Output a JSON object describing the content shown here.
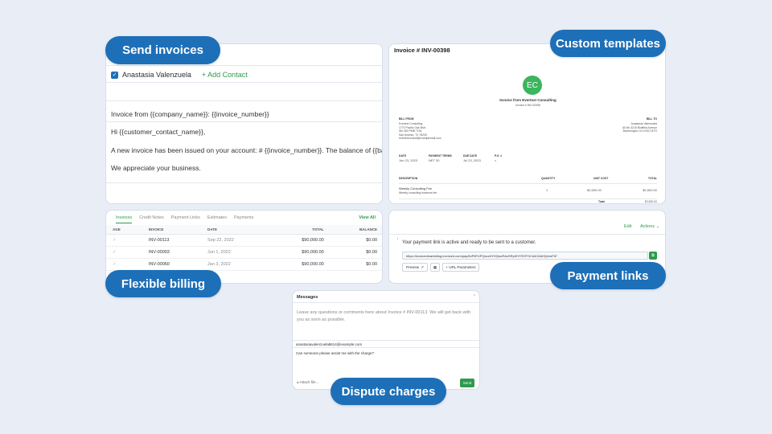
{
  "labels": {
    "send_invoices": "Send invoices",
    "custom_templates": "Custom templates",
    "flexible_billing": "Flexible billing",
    "payment_links": "Payment links",
    "dispute_charges": "Dispute charges"
  },
  "send": {
    "contact_name": "Anastasia Valenzuela",
    "add_contact": "+ Add Contact",
    "subject": "Invoice from {{company_name}}: {{invoice_number}}",
    "greeting": "Hi {{customer_contact_name}},",
    "body": "A new invoice has been issued on your account: # {{invoice_number}}. The balance of {{balance}}",
    "closing": "We appreciate your business."
  },
  "template": {
    "title": "Invoice # INV-00398",
    "logo_initials": "EC",
    "heading": "Invoice from Evertext Consulting",
    "sub": "Invoice # INV-00398",
    "bill_from_label": "BILL FROM",
    "bill_from_lines": [
      "Evertext Consulting",
      "1770 Pacific Oak Blvd",
      "Ste 300 PMB 7154",
      "San Antonio, TX 78249",
      "evertextconsult@examplemail.com"
    ],
    "bill_to_label": "BILL TO",
    "bill_to_lines": [
      "Anastasia Valenzuela",
      "All 4th 3215 Bluffield Avenue",
      "Bloomington, IN 47401 BTO"
    ],
    "meta_labels": [
      "DATE",
      "PAYMENT TERMS",
      "DUE DATE",
      "P.O. #"
    ],
    "meta_values": [
      "Jun 23, 2023",
      "NET 30",
      "Jul 23, 2023",
      "×"
    ],
    "col_description": "DESCRIPTION",
    "col_quantity": "QUANTITY",
    "col_unit_cost": "UNIT COST",
    "col_total": "TOTAL",
    "item_name": "Weekly Consulting Fee",
    "item_desc": "Weekly consulting business fee",
    "item_qty": "1",
    "item_unit": "$2,500.00",
    "item_total": "$2,500.00",
    "total_label": "Total",
    "total_value": "$2,500.00"
  },
  "billing": {
    "tabs": [
      "Invoices",
      "Credit Notes",
      "Payment Links",
      "Estimates",
      "Payments"
    ],
    "view_all": "View All",
    "columns": [
      "AGE",
      "INVOICE",
      "DATE",
      "TOTAL",
      "BALANCE"
    ],
    "rows": [
      {
        "invoice": "INV-00113",
        "date": "Sep 22, 2022",
        "total": "$90,000.00",
        "balance": "$0.00"
      },
      {
        "invoice": "INV-00003",
        "date": "Jun 1, 2022",
        "total": "$90,000.00",
        "balance": "$0.00"
      },
      {
        "invoice": "INV-00060",
        "date": "Jan 3, 2022",
        "total": "$90,000.00",
        "balance": "$0.00"
      }
    ]
  },
  "payment": {
    "edit": "Edit",
    "actions": "Actions ⌄",
    "message": "Your payment link is active and ready to be sent to a customer.",
    "url": "https://invoicedmarketing.invoiced.com/pay/8vP6FUPQsvzDYHQsoRAsSRyWYf7fOFOCd4C6AHQAmF87",
    "preview": "Preview",
    "url_params": "+ URL Parameters"
  },
  "messages": {
    "header": "Messages",
    "hint": "Leave any questions or comments here about Invoice # INV-00113. We will get back with you as soon as possible.",
    "email": "anastasiavalenzuela8614@example.com",
    "body": "Can someone please assist me with the charge?",
    "attach": "Attach file...",
    "send": "Send"
  },
  "icons": {
    "check": "check-icon",
    "copy": "copy-icon",
    "external": "external-link-icon",
    "qr": "qr-icon",
    "close": "chevron-icon",
    "paperclip": "paperclip-icon"
  },
  "colors": {
    "brand_blue": "#1d6fb8",
    "accent_green": "#2e9a4e",
    "logo_green": "#3bb55e",
    "background": "#e9eef6"
  }
}
